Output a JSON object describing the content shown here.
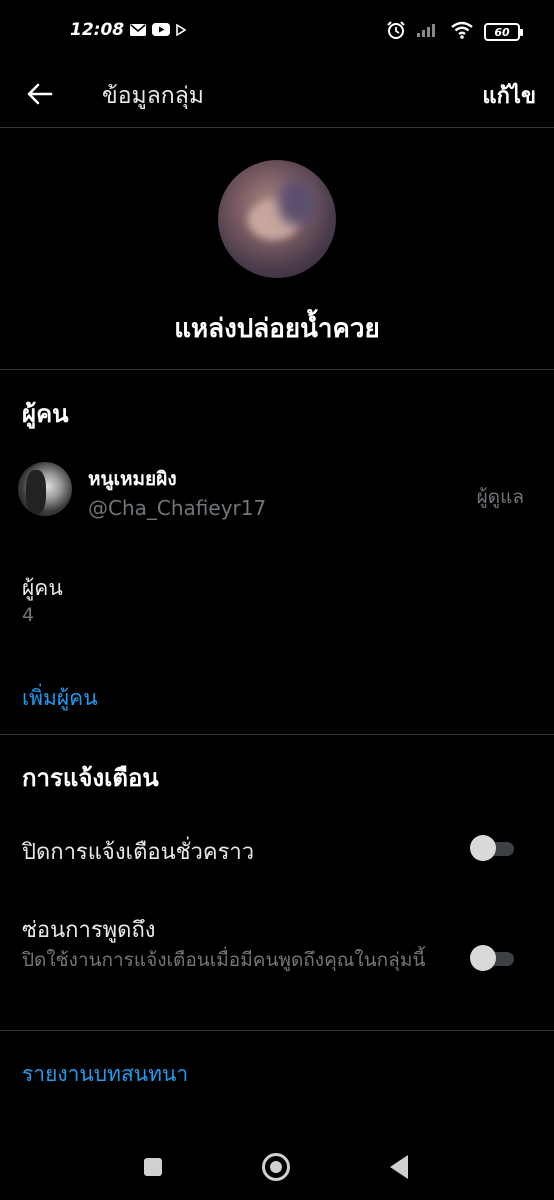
{
  "status_bar": {
    "time": "12:08",
    "left_icons": [
      "mail-icon",
      "youtube-icon",
      "play-store-icon"
    ],
    "right_icons": [
      "alarm-icon",
      "signal-icon",
      "wifi-icon",
      "battery-icon"
    ],
    "battery_level": "60"
  },
  "header": {
    "back_icon": "arrow-left-icon",
    "title": "ข้อมูลกลุ่ม",
    "edit_label": "แก้ไข"
  },
  "group": {
    "name": "แหล่งปล่อยน้ำควย"
  },
  "people_section": {
    "title": "ผู้คน",
    "members": [
      {
        "name": "หนูเหมยผิง",
        "handle": "@Cha_Chafieyr17",
        "role": "ผู้ดูแล"
      }
    ],
    "count_label": "ผู้คน",
    "count_value": "4",
    "add_people_label": "เพิ่มผู้คน"
  },
  "notifications_section": {
    "title": "การแจ้งเตือน",
    "snooze": {
      "label": "ปิดการแจ้งเตือนชั่วคราว",
      "enabled": false
    },
    "mentions": {
      "label": "ซ่อนการพูดถึง",
      "description": "ปิดใช้งานการแจ้งเตือนเมื่อมีคนพูดถึงคุณในกลุ่มนี้",
      "enabled": false
    }
  },
  "report": {
    "label": "รายงานบทสนทนา"
  },
  "colors": {
    "background": "#000000",
    "text_primary": "#e7e9ea",
    "text_secondary": "#71767b",
    "accent": "#1d9bf0",
    "divider": "#2f3336"
  }
}
